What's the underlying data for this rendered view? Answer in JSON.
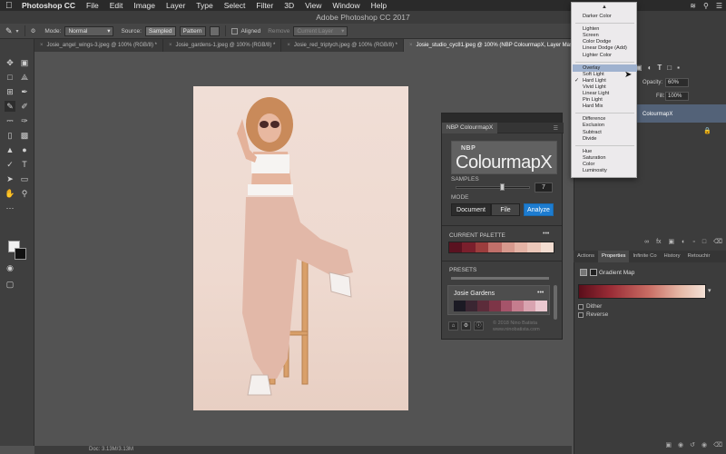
{
  "menubar": {
    "apple": "",
    "items": [
      "Photoshop CC",
      "File",
      "Edit",
      "Image",
      "Layer",
      "Type",
      "Select",
      "Filter",
      "3D",
      "View",
      "Window",
      "Help"
    ]
  },
  "window_title": "Adobe Photoshop CC 2017",
  "options": {
    "mode_label": "Mode:",
    "mode_value": "Normal",
    "source_label": "Source:",
    "sampled": "Sampled",
    "pattern": "Pattern",
    "aligned": "Aligned",
    "remove_label": "Remove",
    "current_layer": "Current Layer"
  },
  "tabs": [
    {
      "label": "Josie_angel_wings-3.jpeg @ 100% (RGB/8) *"
    },
    {
      "label": "Josie_gardens-1.jpeg @ 100% (RGB/8) *"
    },
    {
      "label": "Josie_red_triptych.jpeg @ 100% (RGB/8) *"
    },
    {
      "label": "Josie_studio_cyc81.jpeg @ 100% (NBP ColourmapX, Layer Mask/8) *"
    }
  ],
  "status": {
    "doc": "Doc: 3.13M/3.13M"
  },
  "plugin": {
    "tab": "NBP ColourmapX",
    "logo_small": "NBP",
    "logo_big": "ColourmapX",
    "samples_label": "SAMPLES",
    "samples_value": "7",
    "samples_fraction": 0.62,
    "mode_label": "MODE",
    "mode_buttons": [
      "Document",
      "File",
      "Analyze"
    ],
    "current_palette_label": "CURRENT PALETTE",
    "current_palette_menu": "•••",
    "current_palette": [
      "#5a1220",
      "#7a1f2c",
      "#9b3d3d",
      "#c0706a",
      "#d7998d",
      "#e4b3a5",
      "#ecc8ba",
      "#f3ddd1"
    ],
    "presets_label": "PRESETS",
    "preset_name": "Josie Gardens",
    "preset_menu": "•••",
    "preset_palette": [
      "#1b1a24",
      "#3a2632",
      "#5c2c3a",
      "#7d3547",
      "#a5546a",
      "#c57d8e",
      "#d9a3b0",
      "#ebc8d0"
    ],
    "copyright_line1": "© 2018 Nino Batista",
    "copyright_line2": "www.ninobatista.com",
    "accent": "#1d7cd0"
  },
  "layers": {
    "opacity_label": "Opacity:",
    "opacity_value": "60%",
    "fill_label": "Fill:",
    "fill_value": "100%",
    "layer_name": "ColourmapX"
  },
  "properties": {
    "tabs": [
      "Actions",
      "Properties",
      "Infinite Co",
      "History",
      "Retouchir"
    ],
    "title": "Gradient Map",
    "dither": "Dither",
    "reverse": "Reverse",
    "gradient_colors": [
      "#5a0e1a",
      "#9a2c36",
      "#c96c63",
      "#e6b8a6",
      "#f3e1d6"
    ]
  },
  "blend_dropdown": {
    "checked": "Hard Light",
    "highlighted": "Overlay",
    "groups": [
      [
        "Darker Color"
      ],
      [
        "Lighten",
        "Screen",
        "Color Dodge",
        "Linear Dodge (Add)",
        "Lighter Color"
      ],
      [
        "Overlay",
        "Soft Light",
        "Hard Light",
        "Vivid Light",
        "Linear Light",
        "Pin Light",
        "Hard Mix"
      ],
      [
        "Difference",
        "Exclusion",
        "Subtract",
        "Divide"
      ],
      [
        "Hue",
        "Saturation",
        "Color",
        "Luminosity"
      ]
    ]
  }
}
